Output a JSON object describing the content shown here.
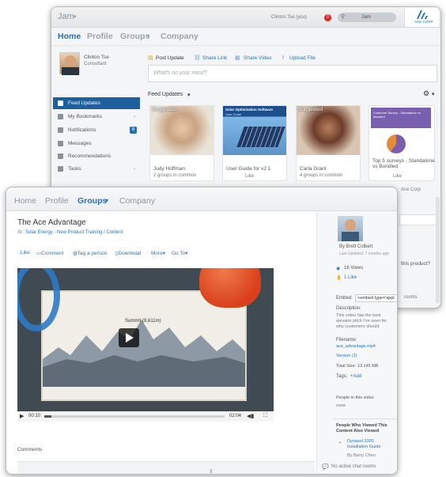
{
  "back": {
    "app_title": "Jam",
    "user_menu": "Clinton Tse (you)",
    "notif_count": "0",
    "search_placeholder": "Jam",
    "logo_text": "ACE CORP",
    "nav": [
      "Home",
      "Profile",
      "Groups",
      "Company"
    ],
    "profile": {
      "name": "Clinton Tse",
      "role": "Consultant"
    },
    "post_actions": [
      "Post Update",
      "Share Link",
      "Share Video",
      "Upload File"
    ],
    "post_placeholder": "What's on your mind?",
    "feed_label": "Feed Updates",
    "sidebar": [
      {
        "label": "Feed Updates",
        "icon": "feed-icon"
      },
      {
        "label": "My Bookmarks",
        "icon": "bookmark-icon"
      },
      {
        "label": "Notifications",
        "icon": "bell-icon",
        "badge": "8"
      },
      {
        "label": "Messages",
        "icon": "mail-icon"
      },
      {
        "label": "Recommendations",
        "icon": "bulb-icon"
      },
      {
        "label": "Tasks",
        "icon": "check-icon"
      }
    ],
    "cards": [
      {
        "tag": "Suggested",
        "title": "Judy Hoffman",
        "sub": "2 groups in common",
        "color": "#c9a383"
      },
      {
        "tag": "",
        "banner": "Solar Optimization Software",
        "banner_sub": "User Guide",
        "title": "User Guide for v2.1",
        "sub": "Like",
        "color": "#4d8fcf"
      },
      {
        "tag": "Suggested",
        "title": "Carla Grant",
        "sub": "4 groups in common",
        "color": "#6e3d2a"
      },
      {
        "tag": "",
        "banner": "Customer Survey - Standalone vs Bundled",
        "title": "Top 5 surveys - Standalone vs Bundled",
        "sub": "Like",
        "color": "#8a6fb5"
      }
    ],
    "partial_right": [
      "Ace Corp",
      "this product?",
      "rooms"
    ]
  },
  "front": {
    "nav": [
      "Home",
      "Profile",
      "Groups",
      "Company"
    ],
    "title": "The Ace Advantage",
    "breadcrumb_prefix": "At:",
    "breadcrumb": "Solar Energy - New Product Training / Content",
    "actions": [
      "Like",
      "Comment",
      "Tag a person",
      "Download",
      "More",
      "Go To"
    ],
    "video": {
      "summit": "Summit (8,611m)",
      "time_current": "00:10",
      "time_total": "02:04"
    },
    "comments_label": "Comments",
    "author_by": "By Brett Colbert",
    "last_updated": "Last Updated: 7 months ago",
    "views": "16 Views",
    "likes": "1 Like",
    "embed_label": "Embed:",
    "embed_value": "<embed type='appl",
    "description_label": "Description:",
    "description": "This video has the best elevator pitch I've seen for why customers should",
    "filename_label": "Filename:",
    "filename": "ace_advantage.mp4",
    "version": "Version (1)",
    "total_size": "Total Size: 13.145 MB",
    "tags_label": "Tags:",
    "tags_add": "+Add",
    "people_label": "People in this video",
    "people_value": "none",
    "also_viewed_title": "People Who Viewed This Content Also Viewed",
    "also_viewed_item": "Dynasol 1000 Installation Guide",
    "also_viewed_by": "By Barry Chen",
    "chat": "No active chat rooms"
  }
}
